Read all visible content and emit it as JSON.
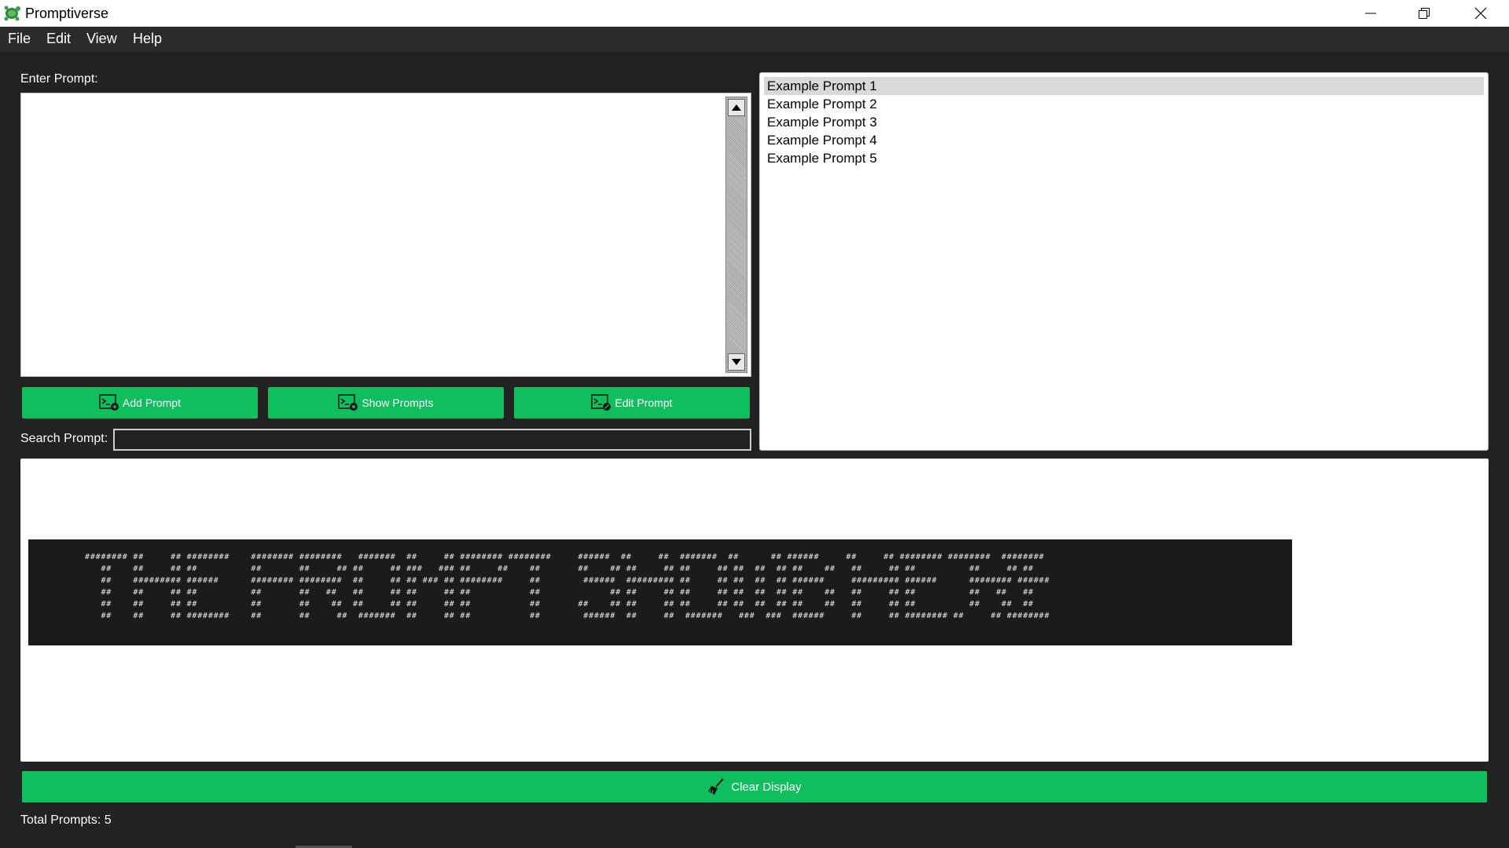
{
  "window": {
    "title": "Promptiverse",
    "icon": "turtle-app-icon"
  },
  "menu": {
    "items": [
      "File",
      "Edit",
      "View",
      "Help"
    ]
  },
  "prompt_input": {
    "label": "Enter Prompt:",
    "value": ""
  },
  "buttons": {
    "add": "Add Prompt",
    "show": "Show Prompts",
    "edit": "Edit Prompt",
    "clear": "Clear Display"
  },
  "search": {
    "label": "Search Prompt:",
    "value": ""
  },
  "prompt_list": {
    "items": [
      "Example Prompt 1",
      "Example Prompt 2",
      "Example Prompt 3",
      "Example Prompt 4",
      "Example Prompt 5"
    ],
    "selected_index": 0
  },
  "display": {
    "banner_lines": [
      "######## ##     ## ########    ######## ########   #######  ##     ## ######## ########     ######  ##     ##  #######  ##      ## ######     ##     ## ######## ########  ########",
      "   ##    ##     ## ##          ##       ##     ## ##     ## ###   ### ##     ##    ##       ##    ## ##     ## ##     ## ##  ##  ## ##    ##   ##     ## ##          ##     ## ##",
      "   ##    ######### ######      ######## ########  ##     ## ## ### ## ########     ##        ######  ######### ##     ## ##  ##  ## ######     ######### ######      ######## ######",
      "   ##    ##     ## ##          ##       ##   ##   ##     ## ##     ## ##           ##             ## ##     ## ##     ## ##  ##  ## ##    ##   ##     ## ##          ##   ##   ##",
      "   ##    ##     ## ##          ##       ##    ##  ##     ## ##     ## ##           ##       ##    ## ##     ## ##     ## ##  ##  ## ##    ##   ##     ## ##          ##    ##  ##",
      "   ##    ##     ## ########    ##       ##     ##  #######  ##     ## ##           ##        ######  ##     ##  #######   ###  ###  ######     ##     ## ######## ##     ## ########"
    ]
  },
  "status": {
    "total_prompts": "Total Prompts: 5"
  },
  "colors": {
    "accent_green": "#0fbf5d",
    "background": "#222222",
    "menubar": "#2b2b2b"
  }
}
